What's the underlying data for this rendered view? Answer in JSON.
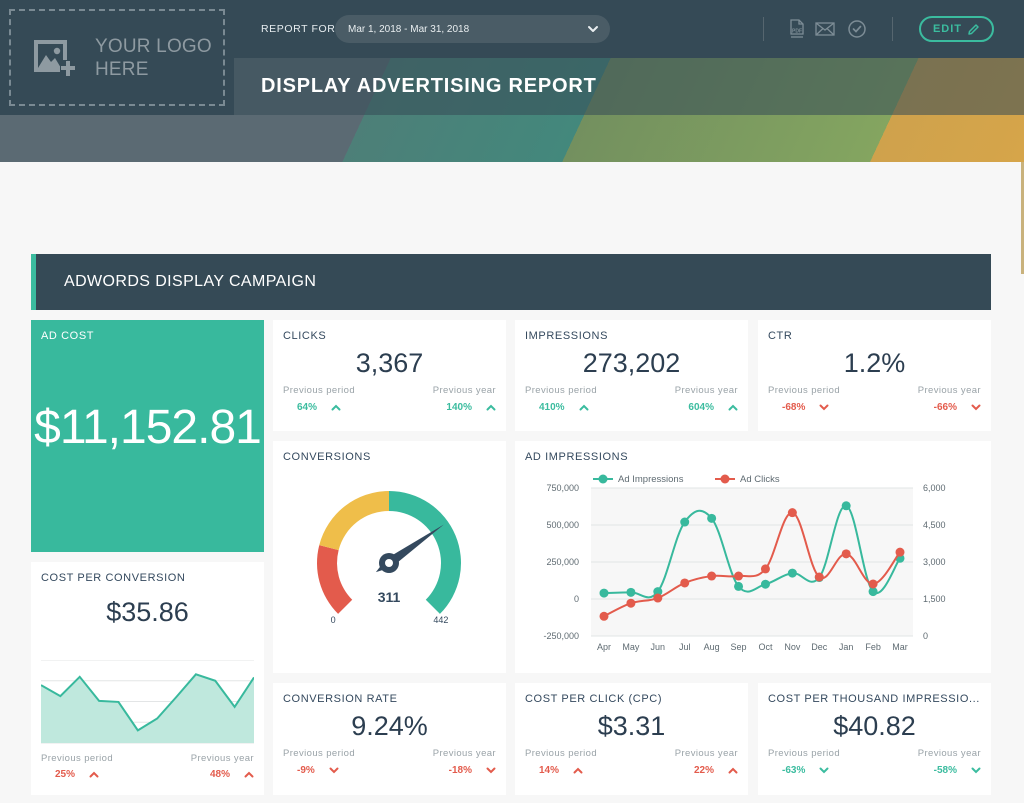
{
  "header": {
    "logo_text_line1": "YOUR LOGO",
    "logo_text_line2": "HERE",
    "report_for_label": "REPORT FOR",
    "date_range": "Mar 1, 2018 - Mar 31, 2018",
    "title": "DISPLAY ADVERTISING REPORT",
    "edit_label": "EDIT",
    "icons": [
      "pdf-icon",
      "mail-icon",
      "check-circle-icon",
      "pencil-icon"
    ]
  },
  "colors": {
    "accent": "#38b99d",
    "positive": "#3bbc9f",
    "negative": "#e35b4c",
    "warning": "#efbe4a",
    "dark": "#354a56"
  },
  "section": {
    "title": "ADWORDS DISPLAY CAMPAIGN"
  },
  "ad_cost": {
    "title": "AD COST",
    "value": "$11,152.81"
  },
  "kpis": {
    "clicks": {
      "title": "CLICKS",
      "value": "3,367",
      "prev_period_label": "Previous period",
      "prev_period": "64%",
      "prev_period_dir": "up",
      "prev_period_status": "good",
      "prev_year_label": "Previous year",
      "prev_year": "140%",
      "prev_year_dir": "up",
      "prev_year_status": "good"
    },
    "impressions": {
      "title": "IMPRESSIONS",
      "value": "273,202",
      "prev_period_label": "Previous period",
      "prev_period": "410%",
      "prev_period_dir": "up",
      "prev_period_status": "good",
      "prev_year_label": "Previous year",
      "prev_year": "604%",
      "prev_year_dir": "up",
      "prev_year_status": "good"
    },
    "ctr": {
      "title": "CTR",
      "value": "1.2%",
      "prev_period_label": "Previous period",
      "prev_period": "-68%",
      "prev_period_dir": "down",
      "prev_period_status": "bad",
      "prev_year_label": "Previous year",
      "prev_year": "-66%",
      "prev_year_dir": "down",
      "prev_year_status": "bad"
    },
    "conversion_rate": {
      "title": "CONVERSION RATE",
      "value": "9.24%",
      "prev_period_label": "Previous period",
      "prev_period": "-9%",
      "prev_period_dir": "down",
      "prev_period_status": "bad",
      "prev_year_label": "Previous year",
      "prev_year": "-18%",
      "prev_year_dir": "down",
      "prev_year_status": "bad"
    },
    "cpc": {
      "title": "COST PER CLICK (CPC)",
      "value": "$3.31",
      "prev_period_label": "Previous period",
      "prev_period": "14%",
      "prev_period_dir": "up",
      "prev_period_status": "bad",
      "prev_year_label": "Previous year",
      "prev_year": "22%",
      "prev_year_dir": "up",
      "prev_year_status": "bad"
    },
    "cpm": {
      "title": "COST PER THOUSAND IMPRESSIO...",
      "value": "$40.82",
      "prev_period_label": "Previous period",
      "prev_period": "-63%",
      "prev_period_dir": "down",
      "prev_period_status": "good",
      "prev_year_label": "Previous year",
      "prev_year": "-58%",
      "prev_year_dir": "down",
      "prev_year_status": "good"
    }
  },
  "cost_per_conversion": {
    "title": "COST PER CONVERSION",
    "value": "$35.86",
    "sparkline": [
      2.79,
      2.26,
      3.19,
      2.03,
      1.98,
      0.61,
      1.18,
      2.23,
      3.31,
      3.0,
      1.74,
      3.16
    ],
    "sparkline_max": 4,
    "prev_period_label": "Previous period",
    "prev_period": "25%",
    "prev_period_dir": "up",
    "prev_period_status": "bad",
    "prev_year_label": "Previous year",
    "prev_year": "48%",
    "prev_year_dir": "up",
    "prev_year_status": "bad"
  },
  "conversions": {
    "title": "CONVERSIONS",
    "value": 311,
    "value_label": "311",
    "min": 0,
    "max": 442,
    "min_label": "0",
    "max_label": "442",
    "bands": [
      {
        "from": 0,
        "to": 0.22,
        "color": "#e35b4c"
      },
      {
        "from": 0.22,
        "to": 0.5,
        "color": "#efbe4a"
      },
      {
        "from": 0.5,
        "to": 1.0,
        "color": "#38b99d"
      }
    ]
  },
  "chart_data": {
    "type": "line",
    "title": "AD IMPRESSIONS",
    "categories": [
      "Apr",
      "May",
      "Jun",
      "Jul",
      "Aug",
      "Sep",
      "Oct",
      "Nov",
      "Dec",
      "Jan",
      "Feb",
      "Mar"
    ],
    "series": [
      {
        "name": "Ad Impressions",
        "axis": "left",
        "color": "#38b99d",
        "values": [
          40000,
          45000,
          50000,
          520000,
          545000,
          85000,
          100000,
          175000,
          145000,
          630000,
          50000,
          275000
        ]
      },
      {
        "name": "Ad Clicks",
        "axis": "right",
        "color": "#e35b4c",
        "values": [
          800,
          1330,
          1540,
          2150,
          2430,
          2430,
          2720,
          5000,
          2390,
          3330,
          2110,
          3400
        ]
      }
    ],
    "y_left": {
      "min": -250000,
      "max": 750000,
      "ticks": [
        "750,000",
        "500,000",
        "250,000",
        "0",
        "-250,000"
      ]
    },
    "y_right": {
      "min": 0,
      "max": 6000,
      "ticks": [
        "6,000",
        "4,500",
        "3,000",
        "1,500",
        "0"
      ]
    },
    "legend": "top-left",
    "grid": true,
    "smooth": true
  }
}
